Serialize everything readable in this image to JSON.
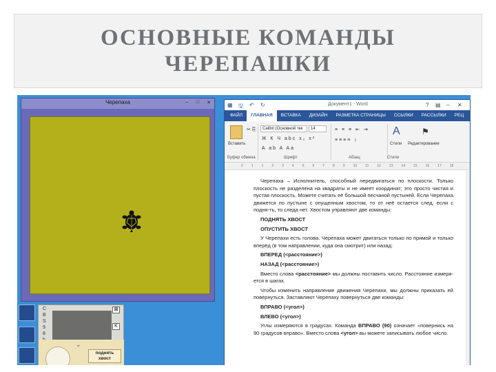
{
  "slide": {
    "title_lines": [
      "ОСНОВНЫЕ КОМАНДЫ",
      "ЧЕРЕПАШКИ"
    ]
  },
  "turtle_window": {
    "title": "Черепаха",
    "buttons": [
      "–",
      "□",
      "✕"
    ],
    "field_color": "#b4b01c",
    "border_color": "#6a6ab8"
  },
  "control_panel": {
    "column_labels": [
      "C",
      "B",
      "S",
      "9",
      "8",
      "b"
    ],
    "button_label": "поднять хвост",
    "close_marks": [
      "⊠",
      "K"
    ]
  },
  "word": {
    "doc_title": "Документ1 - Word",
    "tabs": [
      "ФАЙЛ",
      "ГЛАВНАЯ",
      "ВСТАВКА",
      "ДИЗАЙН",
      "РАЗМЕТКА СТРАНИЦЫ",
      "ССЫЛКИ",
      "РАССЫЛКИ",
      "РЕЦ"
    ],
    "active_tab": "ГЛАВНАЯ",
    "ribbon": {
      "paste_label": "Вставить",
      "font_name": "Calibri (Основной тек",
      "font_size": "14",
      "styles_label": "Стили",
      "editing_label": "Редактирование",
      "group_labels": [
        "Буфер обмена",
        "Шрифт",
        "Абзац",
        "Стили"
      ]
    },
    "ruler_marks": [
      "2",
      "1",
      "1",
      "2",
      "3",
      "4",
      "5",
      "6",
      "7",
      "8",
      "9",
      "10",
      "11",
      "12",
      "13",
      "14",
      "15",
      "16",
      "17",
      "18"
    ],
    "body": {
      "p1": "Черепаха – Исполнитель, способный передвигаться по плоскости. Только плоскость не разделена на квадраты и не имеет координат; это просто чистая и пустая плоскость. Можете считать её большой песчаной пустыней. Если Черепаха движется по пустыне с опущенным хвостом, то от неё остается след, если с подня-ть, то следа нет. Хвостом управляют две команды:",
      "cmd_up": "ПОДНЯТЬ ХВОСТ",
      "cmd_down": "ОПУСТИТЬ ХВОСТ",
      "p2": "У Черепахи есть голова. Черепаха может двигаться только по прямой и только вперёд (в том направлении, куда она смотрит) или назад:",
      "cmd_fwd": "ВПЕРЕД (<расстояние>)",
      "cmd_back": "НАЗАД (<расстояние>)",
      "p3_a": "Вместо слова ",
      "p3_b": "<расстояние>",
      "p3_c": " мы должны поставить число. Расстояние измеря-ется в шагах.",
      "p4": "Чтобы изменить направление движения Черепахи, мы должны приказать ей повернуться. Заставляют Черепаху повернуться две команды:",
      "cmd_right": "ВПРАВО (<угол>)",
      "cmd_left": "ВЛЕВО (<угол>)",
      "p5_a": "Углы измеряются в градусах. Команда ",
      "p5_b": "ВПРАВО (90)",
      "p5_c": " означает «повернись на 90 градусов вправо». Вместо слова ",
      "p5_d": "<угол>",
      "p5_e": " вы можете записывать любое число."
    }
  }
}
